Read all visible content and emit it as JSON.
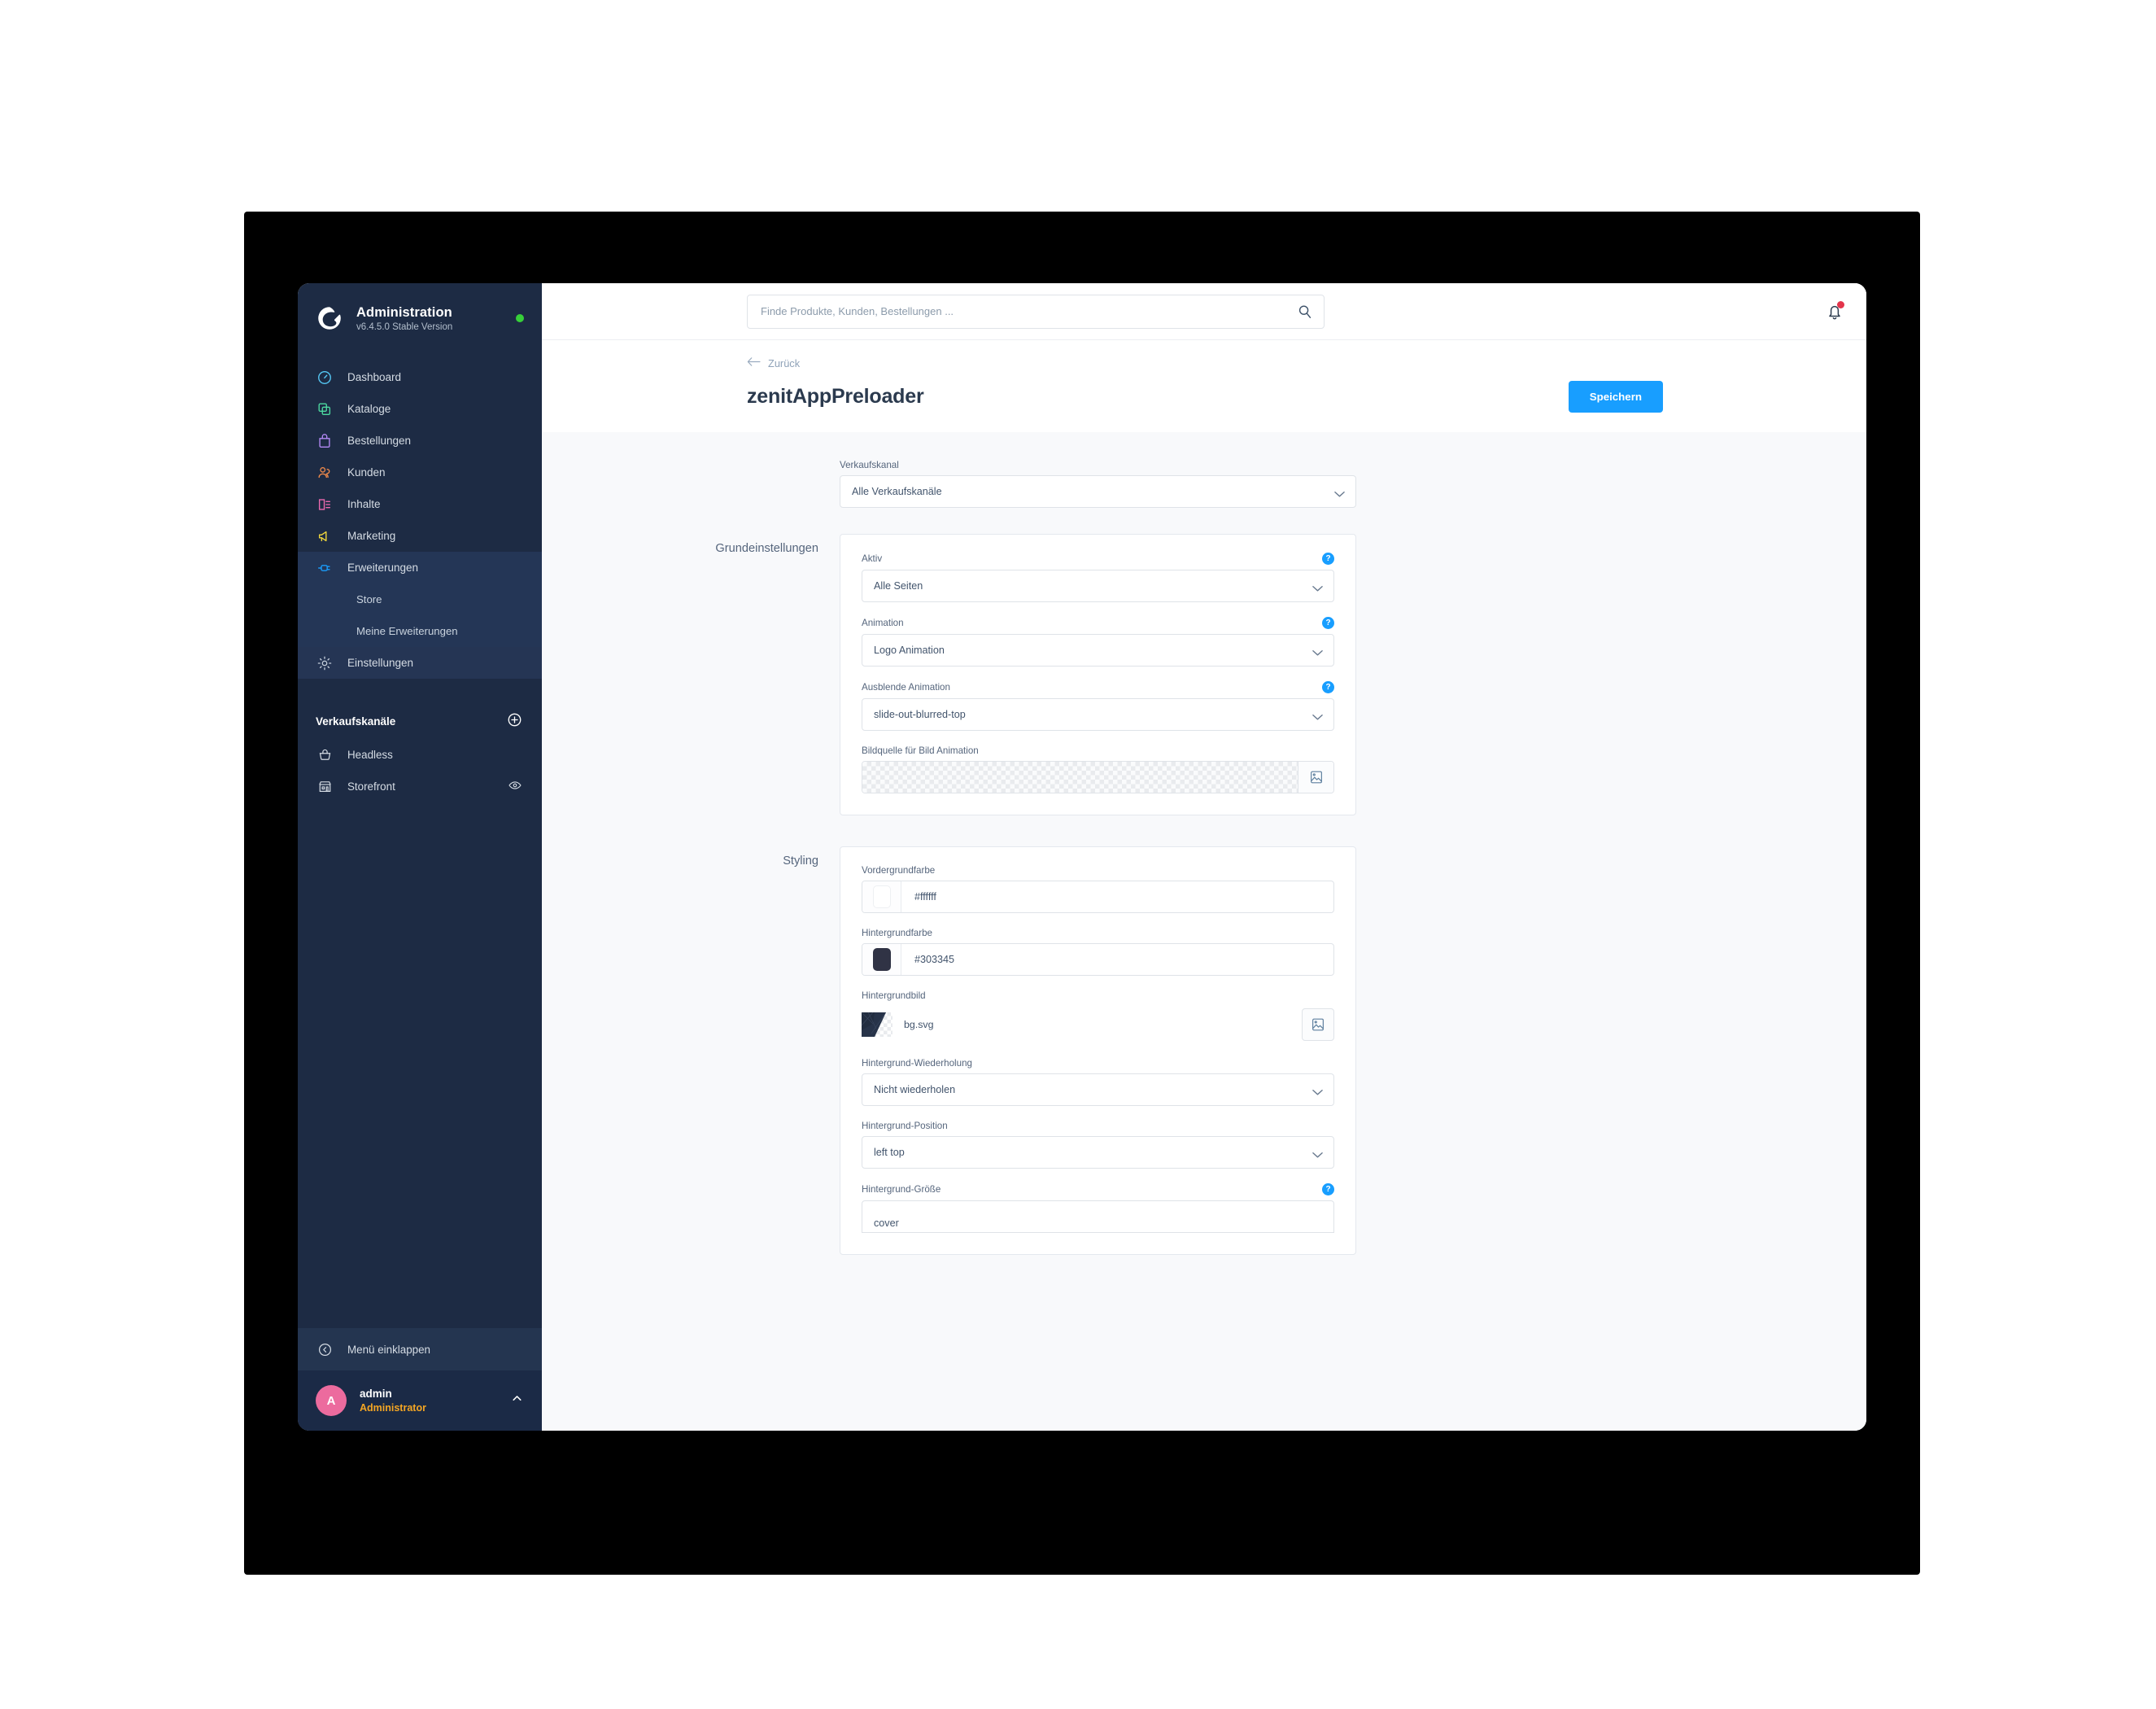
{
  "sidebar": {
    "brand": {
      "title": "Administration",
      "version": "v6.4.5.0 Stable Version",
      "status_color": "#37d039"
    },
    "items": [
      {
        "label": "Dashboard",
        "icon": "gauge-icon"
      },
      {
        "label": "Kataloge",
        "icon": "copy-icon"
      },
      {
        "label": "Bestellungen",
        "icon": "bag-icon"
      },
      {
        "label": "Kunden",
        "icon": "users-icon"
      },
      {
        "label": "Inhalte",
        "icon": "content-icon"
      },
      {
        "label": "Marketing",
        "icon": "megaphone-icon"
      },
      {
        "label": "Erweiterungen",
        "icon": "plug-icon"
      }
    ],
    "sub_items": [
      {
        "label": "Store"
      },
      {
        "label": "Meine Erweiterungen"
      }
    ],
    "settings": {
      "label": "Einstellungen",
      "icon": "gear-icon"
    },
    "channels_section": {
      "label": "Verkaufskanäle",
      "add_icon": "plus-circle-icon"
    },
    "channels": [
      {
        "label": "Headless",
        "icon": "basket-icon",
        "trailing_icon": ""
      },
      {
        "label": "Storefront",
        "icon": "storefront-icon",
        "trailing_icon": "eye-icon"
      }
    ],
    "collapse": {
      "label": "Menü einklappen",
      "icon": "chevron-left-circle-icon"
    },
    "user": {
      "initial": "A",
      "name": "admin",
      "role": "Administrator",
      "chevron": "chevron-up-icon",
      "avatar_color": "#ec6b9e",
      "role_color": "#f5a623"
    }
  },
  "topbar": {
    "search_placeholder": "Finde Produkte, Kunden, Bestellungen ...",
    "search_value": "",
    "search_icon": "search-icon",
    "bell_icon": "bell-icon",
    "bell_has_badge": true,
    "badge_color": "#e3344b"
  },
  "header": {
    "back_label": "Zurück",
    "back_icon": "arrow-left-icon",
    "page_title": "zenitAppPreloader",
    "save_label": "Speichern",
    "save_color": "#189eff"
  },
  "form": {
    "sales_channel": {
      "label": "Verkaufskanal",
      "value": "Alle Verkaufskanäle"
    },
    "sections": [
      {
        "title": "Grundeinstellungen",
        "fields": [
          {
            "type": "select",
            "label": "Aktiv",
            "value": "Alle Seiten",
            "help": "?"
          },
          {
            "type": "select",
            "label": "Animation",
            "value": "Logo Animation",
            "help": "?"
          },
          {
            "type": "select",
            "label": "Ausblende Animation",
            "value": "slide-out-blurred-top",
            "help": "?"
          },
          {
            "type": "image",
            "label": "Bildquelle für Bild Animation",
            "value": "",
            "button_icon": "image-icon"
          }
        ]
      },
      {
        "title": "Styling",
        "fields": [
          {
            "type": "color",
            "label": "Vordergrundfarbe",
            "value": "#ffffff",
            "swatch": "#ffffff"
          },
          {
            "type": "color",
            "label": "Hintergrundfarbe",
            "value": "#303345",
            "swatch": "#303345"
          },
          {
            "type": "file",
            "label": "Hintergrundbild",
            "value": "bg.svg",
            "button_icon": "image-icon"
          },
          {
            "type": "select",
            "label": "Hintergrund-Wiederholung",
            "value": "Nicht wiederholen"
          },
          {
            "type": "select",
            "label": "Hintergrund-Position",
            "value": "left top"
          },
          {
            "type": "select",
            "label": "Hintergrund-Größe",
            "value": "cover",
            "help": "?"
          }
        ]
      }
    ]
  }
}
